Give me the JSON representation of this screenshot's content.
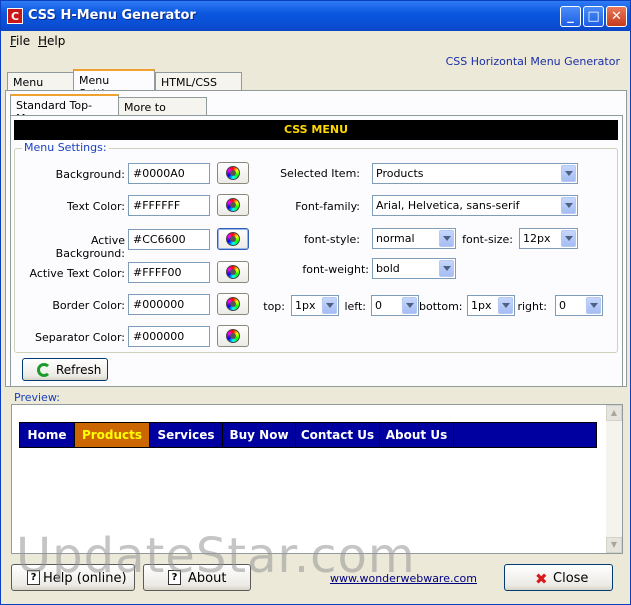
{
  "window": {
    "title": "CSS H-Menu Generator"
  },
  "menubar": {
    "file": "File",
    "file_key": "F",
    "file_rest": "ile",
    "help": "Help",
    "help_key": "H",
    "help_rest": "elp"
  },
  "header": {
    "subtitle": "CSS Horizontal Menu Generator"
  },
  "main_tabs": [
    {
      "label": "Menu Items"
    },
    {
      "label": "Menu Settings",
      "active": true
    },
    {
      "label": "HTML/CSS Code"
    }
  ],
  "sub_tabs": [
    {
      "label": "Standard Top-Menu",
      "active": true
    },
    {
      "label": "More to Come..."
    }
  ],
  "banner": {
    "text": "CSS MENU"
  },
  "settings": {
    "legend": "Menu Settings:",
    "colors": [
      {
        "label": "Background:",
        "value": "#0000A0"
      },
      {
        "label": "Text Color:",
        "value": "#FFFFFF"
      },
      {
        "label": "Active Background:",
        "value": "#CC6600"
      },
      {
        "label": "Active Text Color:",
        "value": "#FFFF00"
      },
      {
        "label": "Border Color:",
        "value": "#000000"
      },
      {
        "label": "Separator Color:",
        "value": "#000000"
      }
    ],
    "selected_item": {
      "label": "Selected Item:",
      "value": "Products"
    },
    "font_family": {
      "label": "Font-family:",
      "value": "Arial, Helvetica, sans-serif"
    },
    "font_style": {
      "label": "font-style:",
      "value": "normal"
    },
    "font_size": {
      "label": "font-size:",
      "value": "12px"
    },
    "font_weight": {
      "label": "font-weight:",
      "value": "bold"
    },
    "padding": {
      "top": {
        "label": "top:",
        "value": "1px"
      },
      "left": {
        "label": "left:",
        "value": "0"
      },
      "bottom": {
        "label": "bottom:",
        "value": "1px"
      },
      "right": {
        "label": "right:",
        "value": "0"
      }
    },
    "refresh_label": "Refresh"
  },
  "preview": {
    "legend": "Preview:",
    "menu_items": [
      "Home",
      "Products",
      "Services",
      "Buy Now",
      "Contact Us",
      "About Us"
    ],
    "active_item": "Products",
    "colors": {
      "background": "#0000A0",
      "text": "#FFFFFF",
      "active_background": "#CC6600",
      "active_text": "#FFFF00"
    }
  },
  "footer": {
    "help_online": "Help (online)",
    "about": "About",
    "website": "www.wonderwebware.com",
    "close": "Close"
  },
  "watermark": "UpdateStar.com"
}
